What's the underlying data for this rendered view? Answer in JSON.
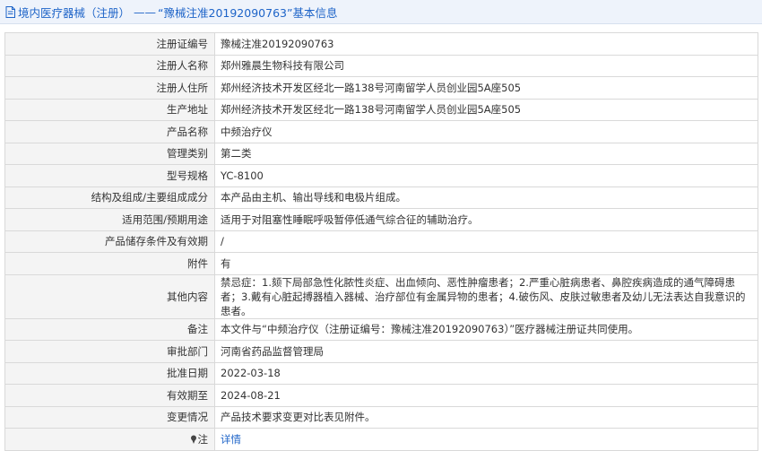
{
  "header": {
    "category": "境内医疗器械（注册）",
    "separator": "——",
    "reg_quoted": "“豫械注准20192090763”",
    "suffix": "基本信息"
  },
  "rows": [
    {
      "label": "注册证编号",
      "value": "豫械注准20192090763"
    },
    {
      "label": "注册人名称",
      "value": "郑州雅晨生物科技有限公司"
    },
    {
      "label": "注册人住所",
      "value": "郑州经济技术开发区经北一路138号河南留学人员创业园5A座505"
    },
    {
      "label": "生产地址",
      "value": "郑州经济技术开发区经北一路138号河南留学人员创业园5A座505"
    },
    {
      "label": "产品名称",
      "value": "中频治疗仪"
    },
    {
      "label": "管理类别",
      "value": "第二类"
    },
    {
      "label": "型号规格",
      "value": "YC-8100"
    },
    {
      "label": "结构及组成/主要组成成分",
      "value": "本产品由主机、输出导线和电极片组成。"
    },
    {
      "label": "适用范围/预期用途",
      "value": "适用于对阻塞性睡眠呼吸暂停低通气综合征的辅助治疗。"
    },
    {
      "label": "产品储存条件及有效期",
      "value": "/"
    },
    {
      "label": "附件",
      "value": "有"
    },
    {
      "label": "其他内容",
      "value": "禁忌症：1.颏下局部急性化脓性炎症、出血倾向、恶性肿瘤患者；2.严重心脏病患者、鼻腔疾病造成的通气障碍患者；3.戴有心脏起搏器植入器械、治疗部位有金属异物的患者；4.破伤风、皮肤过敏患者及幼儿无法表达自我意识的患者。"
    },
    {
      "label": "备注",
      "value": "本文件与“中频治疗仪（注册证编号：豫械注准20192090763）”医疗器械注册证共同使用。"
    },
    {
      "label": "审批部门",
      "value": "河南省药品监督管理局"
    },
    {
      "label": "批准日期",
      "value": "2022-03-18"
    },
    {
      "label": "有效期至",
      "value": "2024-08-21"
    },
    {
      "label": "变更情况",
      "value": "产品技术要求变更对比表见附件。"
    }
  ],
  "note_row": {
    "label": "注",
    "link": "详情"
  },
  "colors": {
    "link": "#1e64c8",
    "header_bg": "#eef3fb",
    "label_bg": "#f4f4f4",
    "border": "#d9d9d9"
  },
  "icons": {
    "header": "document-icon",
    "note": "pin-icon"
  }
}
